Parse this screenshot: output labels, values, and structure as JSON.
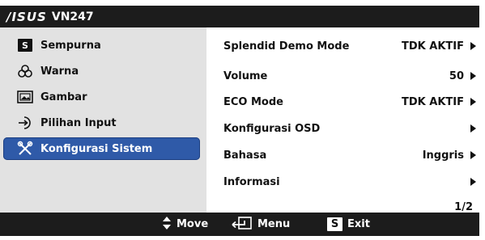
{
  "title": {
    "brand": "/ISUS",
    "model": "VN247"
  },
  "menu": [
    {
      "label": "Sempurna",
      "icon": "splendid-s-icon"
    },
    {
      "label": "Warna",
      "icon": "color-circles-icon"
    },
    {
      "label": "Gambar",
      "icon": "picture-icon"
    },
    {
      "label": "Pilihan Input",
      "icon": "input-arrow-icon"
    },
    {
      "label": "Konfigurasi Sistem",
      "icon": "wrench-screwdriver-icon",
      "selected": true
    }
  ],
  "settings": [
    {
      "label": "Splendid Demo Mode",
      "value": "TDK AKTIF"
    },
    {
      "label": "Volume",
      "value": "50"
    },
    {
      "label": "ECO Mode",
      "value": "TDK AKTIF"
    },
    {
      "label": "Konfigurasi OSD",
      "value": ""
    },
    {
      "label": "Bahasa",
      "value": "Inggris"
    },
    {
      "label": "Informasi",
      "value": ""
    }
  ],
  "page_indicator": "1/2",
  "bottom": {
    "move_label": "Move",
    "menu_label": "Menu",
    "exit_label": "Exit",
    "exit_key": "S"
  },
  "colors": {
    "bar": "#1c1c1c",
    "left_panel": "#e2e2e2",
    "selected": "#2f5aa8"
  }
}
